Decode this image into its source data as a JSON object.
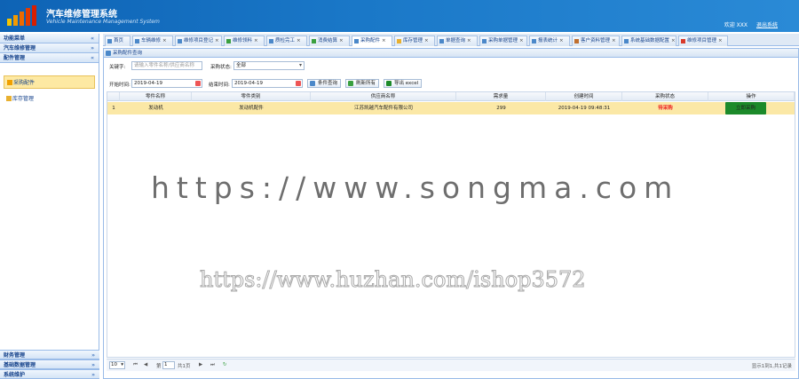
{
  "header": {
    "title": "汽车维修管理系统",
    "subtitle": "Vehicle Maintenance Management System",
    "welcome": "欢迎 XXX",
    "logout": "退出系统"
  },
  "sidebar": {
    "heading": "功能菜单",
    "groups": [
      {
        "label": "汽车维修管理"
      },
      {
        "label": "配件管理"
      }
    ],
    "items": [
      {
        "label": "采购配件"
      },
      {
        "label": "库存管理"
      }
    ],
    "bottom_groups": [
      {
        "label": "财务管理"
      },
      {
        "label": "基础数据管理"
      },
      {
        "label": "系统维护"
      }
    ]
  },
  "tabs": [
    {
      "label": "首页"
    },
    {
      "label": "车辆维修"
    },
    {
      "label": "维修项目登记"
    },
    {
      "label": "维修领料"
    },
    {
      "label": "质检完工"
    },
    {
      "label": "消费结算"
    },
    {
      "label": "采购配件"
    },
    {
      "label": "库存管理"
    },
    {
      "label": "单据查询"
    },
    {
      "label": "采购单据管理"
    },
    {
      "label": "报表统计"
    },
    {
      "label": "客户资料管理"
    },
    {
      "label": "系统基础数据配置"
    },
    {
      "label": "维修项目管理"
    }
  ],
  "panel": {
    "title": "采购配件查询"
  },
  "filters": {
    "keyword_label": "关键字:",
    "keyword_placeholder": "请输入零件名称/供应商名称",
    "status_label": "采购状态:",
    "status_value": "全部",
    "start_label": "开始时间:",
    "start_value": "2019-04-19",
    "end_label": "结束时间:",
    "end_value": "2019-04-19",
    "search_btn": "条件查询",
    "refresh_btn": "刷新所有",
    "export_btn": "导出 excel"
  },
  "grid": {
    "columns": [
      "零件名称",
      "零件类别",
      "供应商名称",
      "需求量",
      "创建时间",
      "采购状态",
      "操作"
    ],
    "rows": [
      {
        "index": "1",
        "part": "发动机",
        "category": "发动机配件",
        "supplier": "江苏凯越汽车配件有限公司",
        "qty": "299",
        "created": "2019-04-19 09:48:31",
        "status": "待采购",
        "action": "立即采购"
      }
    ]
  },
  "pager": {
    "page_size": "10",
    "page_prefix": "第",
    "page_value": "1",
    "page_suffix": "共1页",
    "summary": "显示1到1,共1记录"
  },
  "watermarks": {
    "line1": "https://www.songma.com",
    "line2": "https://www.huzhan.com/ishop3572"
  },
  "colors": {
    "header_blue": "#1a78c8",
    "row_highlight": "#fbe8a6",
    "action_green": "#1c8a2a",
    "status_red": "#e22222"
  }
}
